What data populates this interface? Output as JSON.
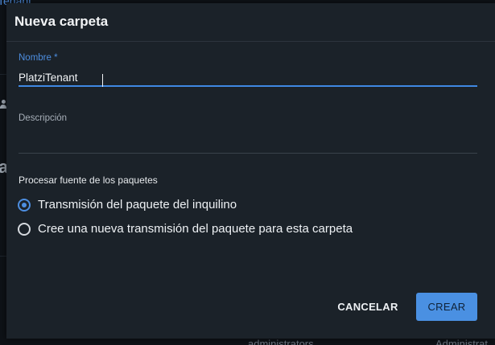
{
  "background": {
    "tenant_text": "Tenant",
    "heading_fragment": "a",
    "admin_1": "administrators",
    "admin_2": "Administrat"
  },
  "dialog": {
    "title": "Nueva carpeta",
    "name_field": {
      "label": "Nombre *",
      "value": "PlatziTenant"
    },
    "description_field": {
      "label": "Descripción",
      "value": ""
    },
    "feed_section_label": "Procesar fuente de los paquetes",
    "options": [
      {
        "label": "Transmisión del paquete del inquilino",
        "checked": true
      },
      {
        "label": "Cree una nueva transmisión del paquete para esta carpeta",
        "checked": false
      }
    ],
    "cancel_label": "CANCELAR",
    "create_label": "CREAR"
  },
  "colors": {
    "dialog_bg": "#1b2229",
    "accent": "#4a90e2",
    "text": "#eef1f4"
  }
}
